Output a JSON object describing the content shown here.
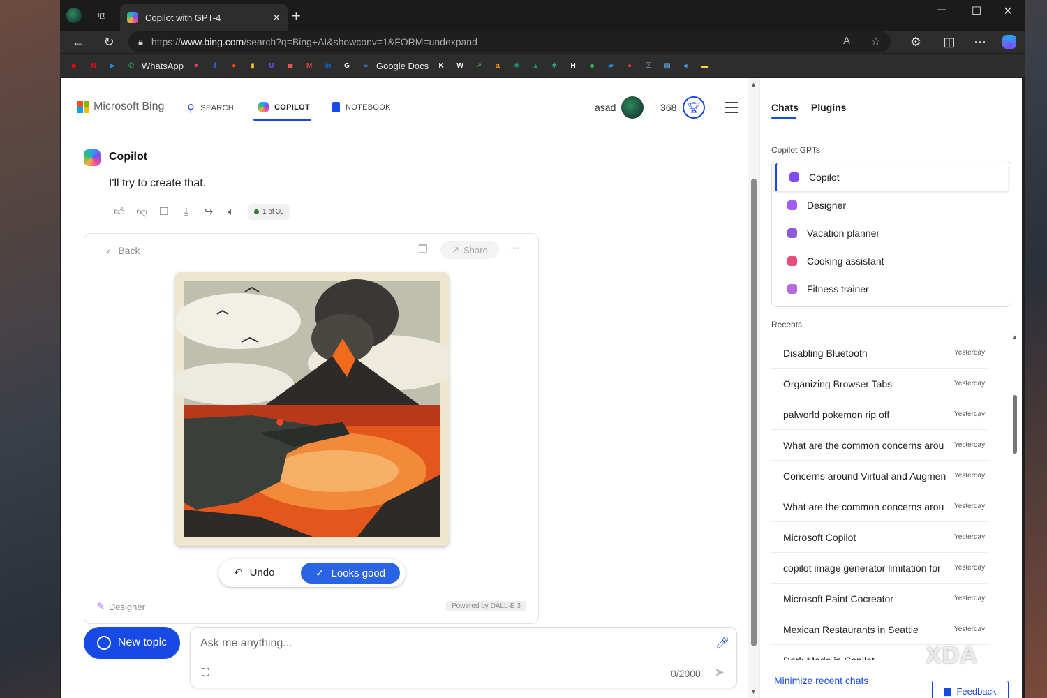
{
  "browser": {
    "tab_title": "Copilot with GPT-4",
    "url_prefix": "https://",
    "url_domain": "www.bing.com",
    "url_rest": "/search?q=Bing+AI&showconv=1&FORM=undexpand",
    "bookmarks": [
      {
        "icon": "youtube-icon",
        "color": "#ff0000",
        "glyph": "▶"
      },
      {
        "icon": "netflix-icon",
        "color": "#e50914",
        "glyph": "N"
      },
      {
        "icon": "play-icon",
        "color": "#1e88e5",
        "glyph": "▶"
      },
      {
        "icon": "whatsapp-icon",
        "color": "#25d366",
        "glyph": "✆",
        "label": "WhatsApp"
      },
      {
        "icon": "pocket-icon",
        "color": "#ef4056",
        "glyph": "♥"
      },
      {
        "icon": "facebook-icon",
        "color": "#1877f2",
        "glyph": "f"
      },
      {
        "icon": "reddit-icon",
        "color": "#ff4500",
        "glyph": "●"
      },
      {
        "icon": "chart-icon",
        "color": "#fbc02d",
        "glyph": "▮"
      },
      {
        "icon": "proton-icon",
        "color": "#6d4aff",
        "glyph": "U"
      },
      {
        "icon": "store-icon",
        "color": "#ef5350",
        "glyph": "◼"
      },
      {
        "icon": "gmail-icon",
        "color": "#ea4335",
        "glyph": "M"
      },
      {
        "icon": "linkedin-icon",
        "color": "#0a66c2",
        "glyph": "in"
      },
      {
        "icon": "google-icon",
        "color": "#ffffff",
        "glyph": "G"
      },
      {
        "icon": "google-docs-icon",
        "color": "#4285f4",
        "glyph": "≡",
        "label": "Google Docs"
      },
      {
        "icon": "k-icon",
        "color": "#ffffff",
        "glyph": "K"
      },
      {
        "icon": "wikipedia-icon",
        "color": "#ffffff",
        "glyph": "W"
      },
      {
        "icon": "arrow-icon",
        "color": "#43a047",
        "glyph": "↗"
      },
      {
        "icon": "amazon-icon",
        "color": "#ff9900",
        "glyph": "a"
      },
      {
        "icon": "chatgpt-icon",
        "color": "#10a37f",
        "glyph": "✺"
      },
      {
        "icon": "drive-icon",
        "color": "#0f9d58",
        "glyph": "▲"
      },
      {
        "icon": "tool-icon",
        "color": "#26a69a",
        "glyph": "✱"
      },
      {
        "icon": "h-icon",
        "color": "#ffffff",
        "glyph": "H"
      },
      {
        "icon": "feedly-icon",
        "color": "#2bb24c",
        "glyph": "◆"
      },
      {
        "icon": "chat-icon",
        "color": "#1e88e5",
        "glyph": "▰"
      },
      {
        "icon": "red-circle-icon",
        "color": "#e53935",
        "glyph": "●"
      },
      {
        "icon": "checkbox-icon",
        "color": "#90caf9",
        "glyph": "☑"
      },
      {
        "icon": "doc-icon",
        "color": "#64b5f6",
        "glyph": "▤"
      },
      {
        "icon": "tag-icon",
        "color": "#42a5f5",
        "glyph": "◈"
      },
      {
        "icon": "line-icon",
        "color": "#fdd835",
        "glyph": "▬"
      }
    ]
  },
  "header": {
    "brand": "Microsoft Bing",
    "nav": [
      {
        "label": "SEARCH",
        "icon": "search-icon"
      },
      {
        "label": "COPILOT",
        "icon": "copilot-icon"
      },
      {
        "label": "NOTEBOOK",
        "icon": "notebook-icon"
      }
    ],
    "user_name": "asad",
    "points": "368"
  },
  "conversation": {
    "assistant_name": "Copilot",
    "message": "I'll try to create that.",
    "pager": "1 of 30",
    "card": {
      "back_label": "Back",
      "share_label": "Share",
      "undo_label": "Undo",
      "looks_good_label": "Looks good",
      "designer_label": "Designer",
      "powered_by": "Powered by DALL·E 3"
    }
  },
  "composer": {
    "new_topic_label": "New topic",
    "placeholder": "Ask me anything...",
    "char_count": "0/2000"
  },
  "side": {
    "tabs": [
      "Chats",
      "Plugins"
    ],
    "gpts_heading": "Copilot GPTs",
    "gpts": [
      {
        "label": "Copilot",
        "color": "#7d4cf2"
      },
      {
        "label": "Designer",
        "color": "#a35cf0"
      },
      {
        "label": "Vacation planner",
        "color": "#8e5bd6"
      },
      {
        "label": "Cooking assistant",
        "color": "#e84d7a"
      },
      {
        "label": "Fitness trainer",
        "color": "#b36be0"
      }
    ],
    "recents_heading": "Recents",
    "recents": [
      {
        "title": "Disabling Bluetooth",
        "date": "Yesterday"
      },
      {
        "title": "Organizing Browser Tabs",
        "date": "Yesterday"
      },
      {
        "title": "palworld pokemon rip off",
        "date": "Yesterday"
      },
      {
        "title": "What are the common concerns arou",
        "date": "Yesterday"
      },
      {
        "title": "Concerns around Virtual and Augment",
        "date": "Yesterday"
      },
      {
        "title": "What are the common concerns arou",
        "date": "Yesterday"
      },
      {
        "title": "Microsoft Copilot",
        "date": "Yesterday"
      },
      {
        "title": "copilot image generator limitation for",
        "date": "Yesterday"
      },
      {
        "title": "Microsoft Paint Cocreator",
        "date": "Yesterday"
      },
      {
        "title": "Mexican Restaurants in Seattle",
        "date": "Yesterday"
      },
      {
        "title": "Dark Mode in Copilot",
        "date": ""
      }
    ],
    "minimize_label": "Minimize recent chats",
    "feedback_label": "Feedback"
  },
  "watermark": "XDA"
}
